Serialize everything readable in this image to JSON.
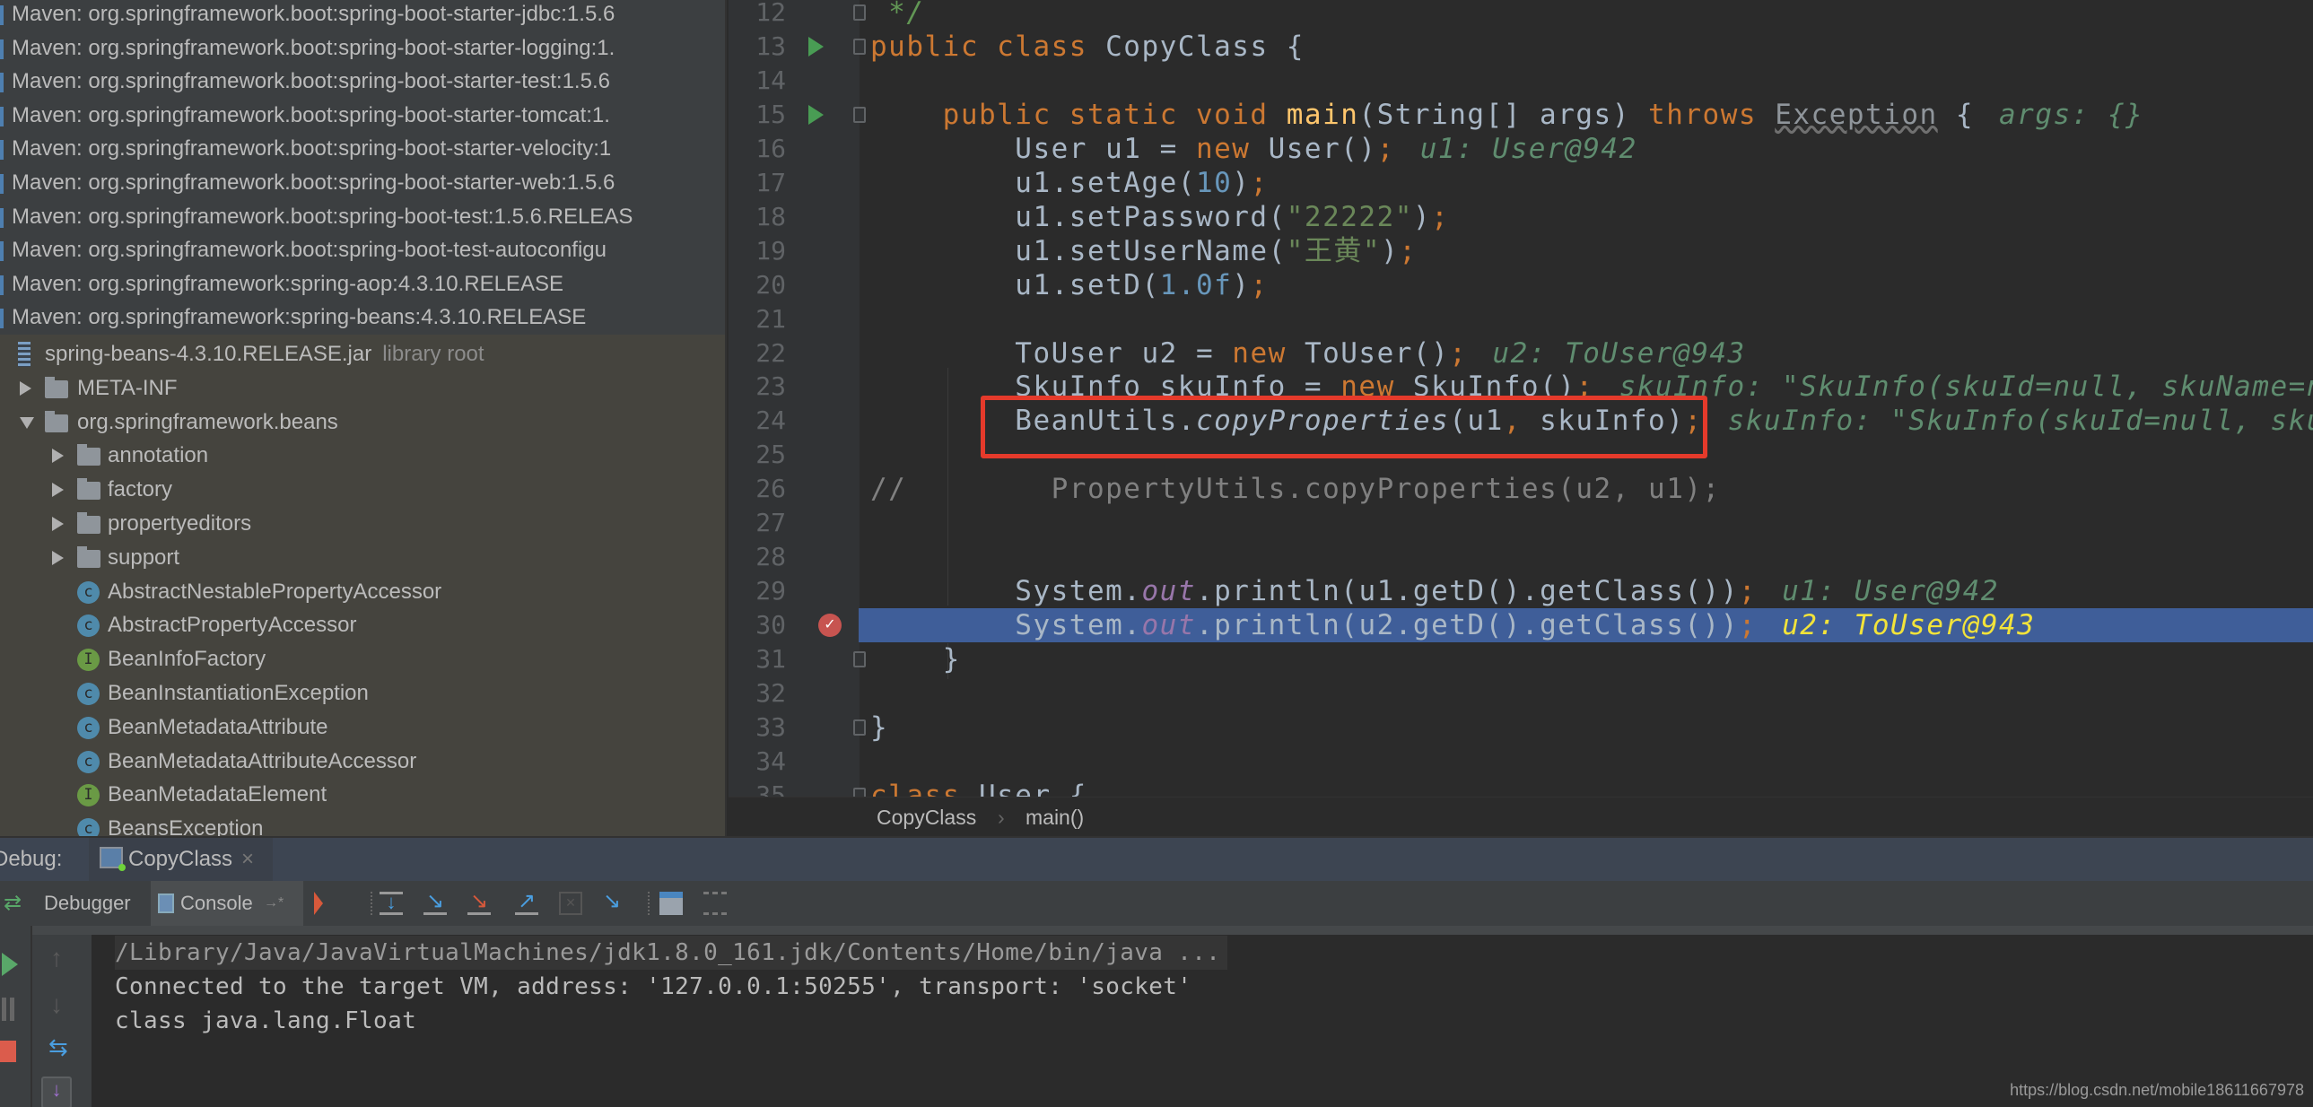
{
  "sidebar": {
    "maven_items": [
      "Maven: org.springframework.boot:spring-boot-starter-jdbc:1.5.6",
      "Maven: org.springframework.boot:spring-boot-starter-logging:1.",
      "Maven: org.springframework.boot:spring-boot-starter-test:1.5.6",
      "Maven: org.springframework.boot:spring-boot-starter-tomcat:1.",
      "Maven: org.springframework.boot:spring-boot-starter-velocity:1",
      "Maven: org.springframework.boot:spring-boot-starter-web:1.5.6",
      "Maven: org.springframework.boot:spring-boot-test:1.5.6.RELEAS",
      "Maven: org.springframework.boot:spring-boot-test-autoconfigu",
      "Maven: org.springframework:spring-aop:4.3.10.RELEASE",
      "Maven: org.springframework:spring-beans:4.3.10.RELEASE"
    ],
    "tree": [
      {
        "label": "spring-beans-4.3.10.RELEASE.jar",
        "suffix": "library root",
        "icon": "jar",
        "arrow": null,
        "level": 0
      },
      {
        "label": "META-INF",
        "icon": "folder",
        "arrow": "collapsed",
        "level": 1
      },
      {
        "label": "org.springframework.beans",
        "icon": "folder",
        "arrow": "expanded",
        "level": 1
      },
      {
        "label": "annotation",
        "icon": "folder",
        "arrow": "collapsed",
        "level": 2
      },
      {
        "label": "factory",
        "icon": "folder",
        "arrow": "collapsed",
        "level": 2
      },
      {
        "label": "propertyeditors",
        "icon": "folder",
        "arrow": "collapsed",
        "level": 2
      },
      {
        "label": "support",
        "icon": "folder",
        "arrow": "collapsed",
        "level": 2
      },
      {
        "label": "AbstractNestablePropertyAccessor",
        "icon": "abstract-class",
        "arrow": null,
        "level": 2
      },
      {
        "label": "AbstractPropertyAccessor",
        "icon": "abstract-class",
        "arrow": null,
        "level": 2
      },
      {
        "label": "BeanInfoFactory",
        "icon": "interface",
        "arrow": null,
        "level": 2
      },
      {
        "label": "BeanInstantiationException",
        "icon": "class",
        "arrow": null,
        "level": 2
      },
      {
        "label": "BeanMetadataAttribute",
        "icon": "class",
        "arrow": null,
        "level": 2
      },
      {
        "label": "BeanMetadataAttributeAccessor",
        "icon": "class",
        "arrow": null,
        "level": 2
      },
      {
        "label": "BeanMetadataElement",
        "icon": "interface",
        "arrow": null,
        "level": 2
      },
      {
        "label": "BeansException",
        "icon": "abstract-class",
        "arrow": null,
        "level": 2
      }
    ]
  },
  "editor": {
    "current_line": 30,
    "breakpoint_line": 30,
    "run_lines": [
      13,
      15
    ],
    "fold_lines": [
      12,
      13,
      15,
      31,
      33,
      35
    ],
    "colors": {
      "keyword": "#cc7832",
      "string": "#6a8759",
      "number": "#6897bb",
      "inline_value": "#5f8c6f",
      "current_line": "#3f5e99",
      "highlight_box": "#e53a2b"
    },
    "lines": [
      {
        "n": "12",
        "tokens": [
          [
            " */",
            "doc"
          ]
        ]
      },
      {
        "n": "13",
        "tokens": [
          [
            "public class ",
            "kw"
          ],
          [
            "CopyClass {",
            ""
          ]
        ]
      },
      {
        "n": "14",
        "tokens": []
      },
      {
        "n": "15",
        "tokens": [
          [
            "    public static void ",
            "kw"
          ],
          [
            "main",
            "fn"
          ],
          [
            "(String[] args) ",
            ""
          ],
          [
            "throws ",
            "kw"
          ],
          [
            "Exception",
            "dim"
          ],
          [
            " {",
            ""
          ]
        ],
        "inlay": "args: {}"
      },
      {
        "n": "16",
        "tokens": [
          [
            "        User u1 = ",
            ""
          ],
          [
            "new ",
            "kw"
          ],
          [
            "User()",
            ""
          ],
          [
            ";",
            "kw"
          ]
        ],
        "inlay": "u1: User@942"
      },
      {
        "n": "17",
        "tokens": [
          [
            "        u1.setAge(",
            ""
          ],
          [
            "10",
            "num"
          ],
          [
            ")",
            ""
          ],
          [
            ";",
            "kw"
          ]
        ]
      },
      {
        "n": "18",
        "tokens": [
          [
            "        u1.setPassword(",
            ""
          ],
          [
            "\"22222\"",
            "str"
          ],
          [
            ")",
            ""
          ],
          [
            ";",
            "kw"
          ]
        ]
      },
      {
        "n": "19",
        "tokens": [
          [
            "        u1.setUserName(",
            ""
          ],
          [
            "\"王黄\"",
            "str"
          ],
          [
            ")",
            ""
          ],
          [
            ";",
            "kw"
          ]
        ]
      },
      {
        "n": "20",
        "tokens": [
          [
            "        u1.setD(",
            ""
          ],
          [
            "1.0f",
            "num"
          ],
          [
            ")",
            ""
          ],
          [
            ";",
            "kw"
          ]
        ]
      },
      {
        "n": "21",
        "tokens": []
      },
      {
        "n": "22",
        "tokens": [
          [
            "        ToUser u2 = ",
            ""
          ],
          [
            "new ",
            "kw"
          ],
          [
            "ToUser()",
            ""
          ],
          [
            ";",
            "kw"
          ]
        ],
        "inlay": "u2: ToUser@943"
      },
      {
        "n": "23",
        "tokens": [
          [
            "        SkuInfo skuInfo = ",
            ""
          ],
          [
            "new ",
            "kw"
          ],
          [
            "SkuInfo()",
            ""
          ],
          [
            ";",
            "kw"
          ]
        ],
        "inlay": "skuInfo: \"SkuInfo(skuId=null, skuName=n"
      },
      {
        "n": "24",
        "tokens": [
          [
            "        BeanUtils.",
            ""
          ],
          [
            "copyProperties",
            "it"
          ],
          [
            "(u1",
            ""
          ],
          [
            ", ",
            "kw"
          ],
          [
            "skuInfo)",
            ""
          ],
          [
            ";",
            "kw"
          ]
        ],
        "inlay": "skuInfo: \"SkuInfo(skuId=null, sku"
      },
      {
        "n": "25",
        "tokens": []
      },
      {
        "n": "26",
        "tokens": [
          [
            "//        PropertyUtils.copyProperties(u2, u1);",
            "cm"
          ]
        ]
      },
      {
        "n": "27",
        "tokens": []
      },
      {
        "n": "28",
        "tokens": []
      },
      {
        "n": "29",
        "tokens": [
          [
            "        System.",
            ""
          ],
          [
            "out",
            "fld"
          ],
          [
            ".println(u1.getD().getClass())",
            ""
          ],
          [
            ";",
            "kw"
          ]
        ],
        "inlay": "u1: User@942"
      },
      {
        "n": "30",
        "tokens": [
          [
            "        System.",
            ""
          ],
          [
            "out",
            "fld"
          ],
          [
            ".println(u2.getD().getClass())",
            ""
          ],
          [
            ";",
            "kw"
          ]
        ],
        "inlay": "u2: ToUser@943"
      },
      {
        "n": "31",
        "tokens": [
          [
            "    }",
            ""
          ]
        ]
      },
      {
        "n": "32",
        "tokens": []
      },
      {
        "n": "33",
        "tokens": [
          [
            "}",
            ""
          ]
        ]
      },
      {
        "n": "34",
        "tokens": []
      },
      {
        "n": "35",
        "tokens": [
          [
            "class ",
            "kw"
          ],
          [
            "User {",
            ""
          ]
        ]
      }
    ]
  },
  "breadcrumb": {
    "items": [
      "CopyClass",
      "main()"
    ],
    "separator": "›"
  },
  "debug": {
    "label": "Debug:",
    "tab": "CopyClass",
    "tab_close": "×",
    "tabs": {
      "debugger": "Debugger",
      "console": "Console",
      "console_pin": "→*"
    },
    "console_lines": [
      "/Library/Java/JavaVirtualMachines/jdk1.8.0_161.jdk/Contents/Home/bin/java ...",
      "Connected to the target VM, address: '127.0.0.1:50255', transport: 'socket'",
      "class java.lang.Float"
    ]
  },
  "watermark": "https://blog.csdn.net/mobile18611667978"
}
